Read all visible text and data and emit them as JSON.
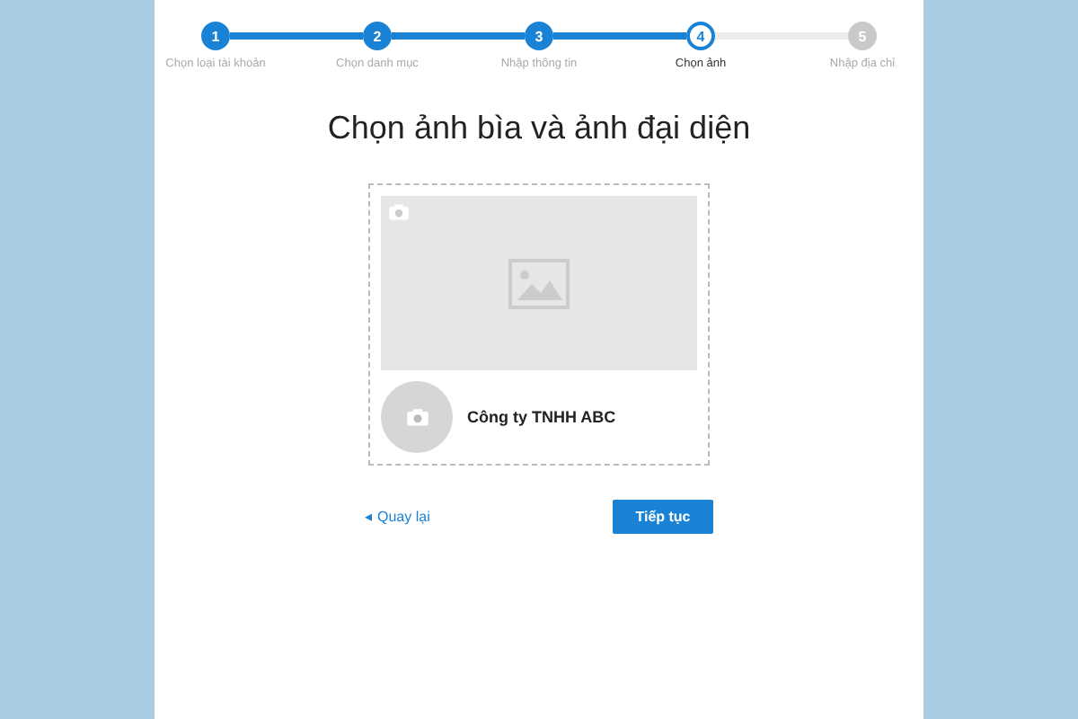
{
  "steps": [
    {
      "number": "1",
      "label": "Chọn loại tài khoản",
      "completed": true,
      "selected": false
    },
    {
      "number": "2",
      "label": "Chọn danh mục",
      "completed": true,
      "selected": false
    },
    {
      "number": "3",
      "label": "Nhập thông tin",
      "completed": true,
      "selected": false
    },
    {
      "number": "4",
      "label": "Chọn ảnh",
      "completed": false,
      "selected": true
    },
    {
      "number": "5",
      "label": "Nhập địa chỉ",
      "completed": false,
      "selected": false
    }
  ],
  "title": "Chọn ảnh bìa và ảnh đại diện",
  "profile": {
    "name": "Công ty TNHH ABC"
  },
  "back_link": {
    "icon": "◂",
    "label": "Quay lại"
  },
  "continue_button": {
    "label": "Tiếp tục"
  }
}
